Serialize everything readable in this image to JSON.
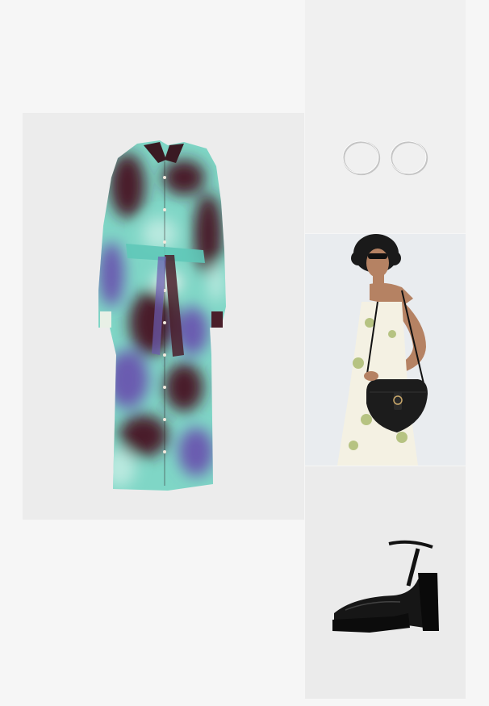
{
  "outfit": {
    "items": [
      {
        "name": "dress",
        "icon": "shirt-dress-image"
      },
      {
        "name": "earrings",
        "icon": "hoop-earrings-image"
      },
      {
        "name": "bag",
        "icon": "crossbody-bag-image"
      },
      {
        "name": "shoes",
        "icon": "platform-heels-image"
      }
    ]
  },
  "colors": {
    "page_background": "#f6f6f6",
    "tile_background": "#ececec",
    "dress_teal": "#5fc8b8",
    "dress_burgundy": "#4a1f2a",
    "dress_purple": "#6b5bb0",
    "leather_black": "#1a1a1a",
    "silver": "#c9c9c9"
  }
}
